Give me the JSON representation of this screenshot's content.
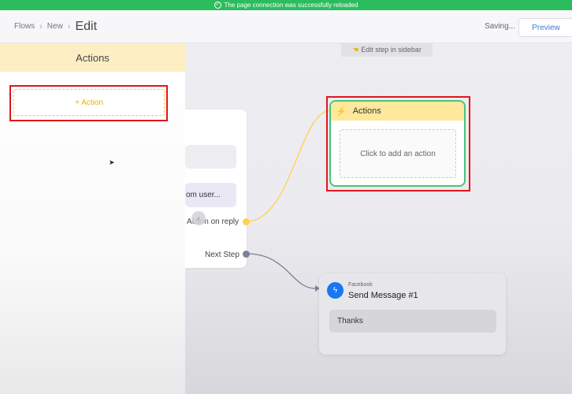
{
  "banner": {
    "text": "The page connection was successfully reloaded"
  },
  "topbar": {
    "breadcrumbs": [
      "Flows",
      "New",
      "Edit"
    ],
    "status": "Saving...",
    "preview_label": "Preview"
  },
  "canvas": {
    "hint": "Edit step in sidebar"
  },
  "sidebar": {
    "title": "Actions",
    "add_action_label": "+ Action"
  },
  "left_node": {
    "partial_text": "om user...",
    "reply_label": "Action on reply",
    "next_step_label": "Next Step"
  },
  "actions_node": {
    "title": "Actions",
    "placeholder": "Click to add an action"
  },
  "message_node": {
    "platform": "Facebook",
    "title": "Send Message #1",
    "message": "Thanks"
  },
  "colors": {
    "banner": "#2bbd5d",
    "accent_yellow": "#f2c94c",
    "node_selected_border": "#4cc27a",
    "highlight_box": "#e0161c",
    "facebook_blue": "#1877f2"
  }
}
